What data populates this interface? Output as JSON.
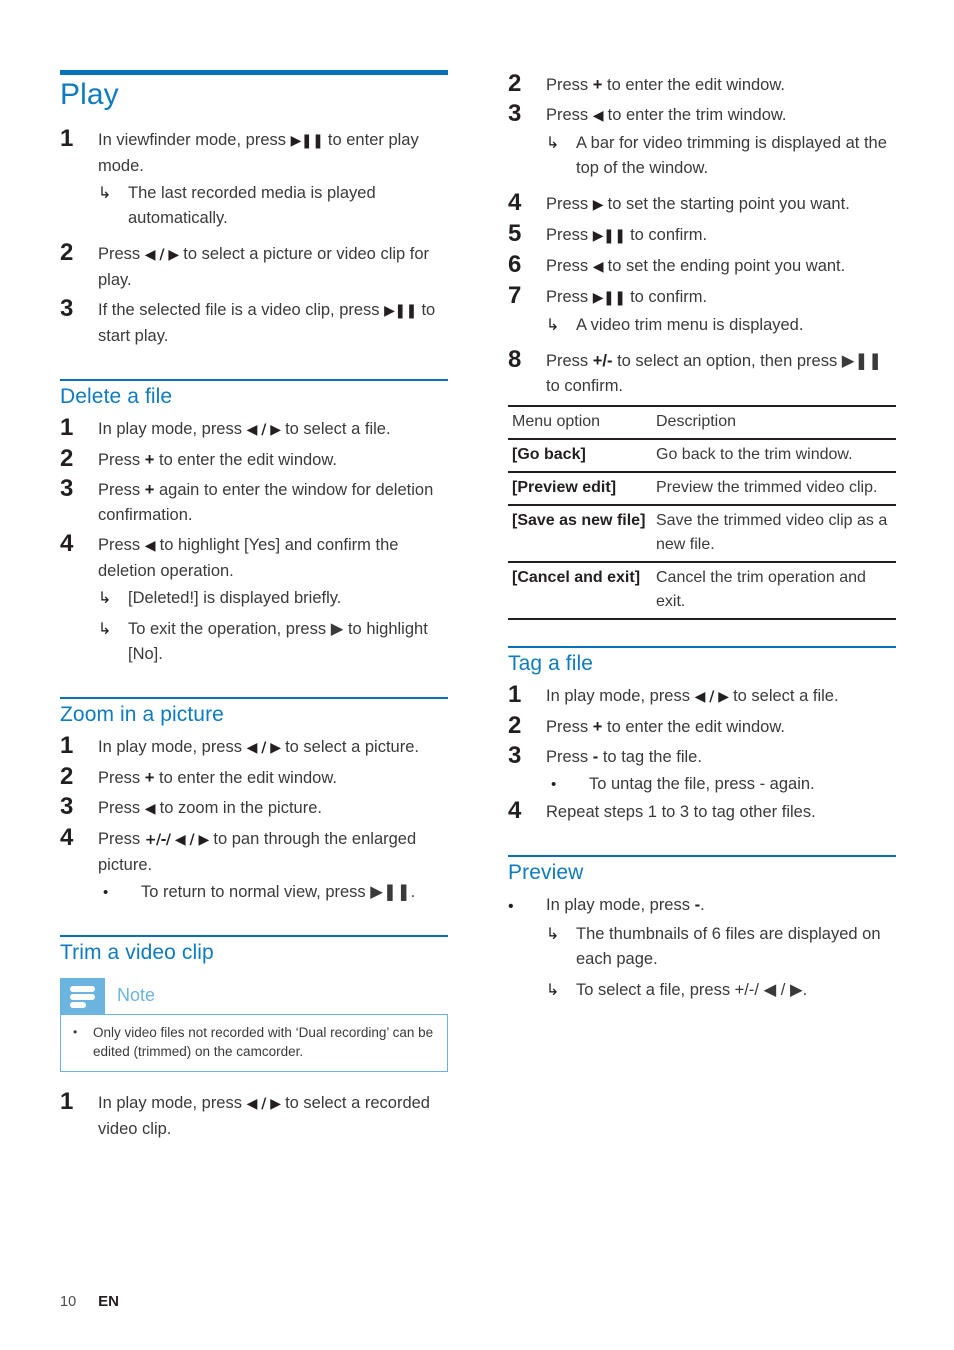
{
  "page": {
    "number": "10",
    "language": "EN"
  },
  "left_column": {
    "main_heading": "Play",
    "play_steps": [
      {
        "num": "1",
        "text_pre": "In viewfinder mode, press ",
        "sym": "▶❚❚",
        "text_post": " to enter play mode.",
        "subnotes": [
          {
            "marker": "↳",
            "text": "The last recorded media is played automatically."
          }
        ]
      },
      {
        "num": "2",
        "text_pre": "Press ",
        "sym": "◀ / ▶",
        "text_post": " to select a picture or video clip for play.",
        "subnotes": []
      },
      {
        "num": "3",
        "text_pre": "If the selected file is a video clip, press ",
        "sym": "▶❚❚",
        "text_post": " to start play.",
        "subnotes": []
      }
    ],
    "delete_heading": "Delete a file",
    "delete_steps": [
      {
        "num": "1",
        "text_pre": "In play mode, press ",
        "sym": "◀ / ▶",
        "text_post": " to select a file.",
        "subnotes": []
      },
      {
        "num": "2",
        "text_pre": "Press ",
        "sym": "+",
        "text_post": " to enter the edit window.",
        "subnotes": []
      },
      {
        "num": "3",
        "text_pre": "Press ",
        "sym": "+",
        "text_post": " again to enter the window for deletion confirmation.",
        "subnotes": []
      },
      {
        "num": "4",
        "text_pre": "Press ",
        "sym": "◀",
        "text_post": " to highlight [Yes] and confirm the deletion operation.",
        "subnotes": [
          {
            "marker": "↳",
            "text": "[Deleted!] is displayed briefly."
          },
          {
            "marker": "↳",
            "text": "To exit the operation, press ▶ to highlight [No]."
          }
        ]
      }
    ],
    "zoom_heading": "Zoom in a picture",
    "zoom_steps": [
      {
        "num": "1",
        "text_pre": "In play mode, press ",
        "sym": "◀ / ▶",
        "text_post": " to select a picture.",
        "subnotes": []
      },
      {
        "num": "2",
        "text_pre": "Press ",
        "sym": "+",
        "text_post": " to enter the edit window.",
        "subnotes": []
      },
      {
        "num": "3",
        "text_pre": "Press ",
        "sym": "◀",
        "text_post": " to zoom in the picture.",
        "subnotes": []
      },
      {
        "num": "4",
        "text_pre": "Press ",
        "sym": "+/-/ ◀ / ▶",
        "text_post": " to pan through the enlarged picture.",
        "subnotes": [
          {
            "marker": "•",
            "text": "To return to normal view, press ▶❚❚."
          }
        ]
      }
    ],
    "trim_heading": "Trim a video clip",
    "note": {
      "label": "Note",
      "bullets": [
        "Only video files not recorded with ‘Dual recording’ can be edited (trimmed) on the camcorder."
      ]
    },
    "trim_steps": [
      {
        "num": "1",
        "text_pre": "In play mode, press ",
        "sym": "◀ / ▶",
        "text_post": " to select a recorded video clip.",
        "subnotes": []
      }
    ]
  },
  "right_column": {
    "trim_steps_cont": [
      {
        "num": "2",
        "text_pre": "Press ",
        "sym": "+",
        "text_post": " to enter the edit window.",
        "subnotes": []
      },
      {
        "num": "3",
        "text_pre": "Press ",
        "sym": "◀",
        "text_post": " to enter the trim window.",
        "subnotes": [
          {
            "marker": "↳",
            "text": "A bar for video trimming is displayed at the top of the window."
          }
        ]
      },
      {
        "num": "4",
        "text_pre": "Press ",
        "sym": "▶",
        "text_post": " to set the starting point you want.",
        "subnotes": []
      },
      {
        "num": "5",
        "text_pre": "Press ",
        "sym": "▶❚❚",
        "text_post": " to confirm.",
        "subnotes": []
      },
      {
        "num": "6",
        "text_pre": "Press ",
        "sym": "◀",
        "text_post": " to set the ending point you want.",
        "subnotes": []
      },
      {
        "num": "7",
        "text_pre": "Press ",
        "sym": "▶❚❚",
        "text_post": " to confirm.",
        "subnotes": [
          {
            "marker": "↳",
            "text": "A video trim menu is displayed."
          }
        ]
      },
      {
        "num": "8",
        "text_pre": "Press ",
        "sym": "+/-",
        "text_post": " to select an option, then press ▶❚❚ to confirm.",
        "subnotes": []
      }
    ],
    "menu_table": {
      "headers": [
        "Menu option",
        "Description"
      ],
      "rows": [
        [
          "[Go back]",
          "Go back to the trim window."
        ],
        [
          "[Preview edit]",
          "Preview the trimmed video clip."
        ],
        [
          "[Save as new file]",
          "Save the trimmed video clip as a new file."
        ],
        [
          "[Cancel and exit]",
          "Cancel the trim operation and exit."
        ]
      ]
    },
    "tag_heading": "Tag a file",
    "tag_steps": [
      {
        "num": "1",
        "text_pre": "In play mode, press ",
        "sym": "◀ / ▶",
        "text_post": " to select a file.",
        "subnotes": []
      },
      {
        "num": "2",
        "text_pre": "Press ",
        "sym": "+",
        "text_post": " to enter the edit window.",
        "subnotes": []
      },
      {
        "num": "3",
        "text_pre": "Press ",
        "sym": "-",
        "text_post": " to tag the file.",
        "subnotes": [
          {
            "marker": "•",
            "text": "To untag the file, press - again."
          }
        ]
      },
      {
        "num": "4",
        "text_pre": "Repeat steps 1 to 3 to tag other files.",
        "sym": "",
        "text_post": "",
        "subnotes": []
      }
    ],
    "preview_heading": "Preview",
    "preview_bullets": [
      {
        "marker": "•",
        "text_pre": "In play mode, press ",
        "sym": "-",
        "text_post": ".",
        "subnotes": [
          {
            "marker": "↳",
            "text": "The thumbnails of 6 files are displayed on each page."
          },
          {
            "marker": "↳",
            "text": "To select a file, press +/-/ ◀ / ▶."
          }
        ]
      }
    ]
  },
  "colors": {
    "heading_blue": "#0e7bc0",
    "rule_blue": "#0571b8",
    "note_blue": "#6cb4e0",
    "body_text": "#3a3a3a"
  }
}
